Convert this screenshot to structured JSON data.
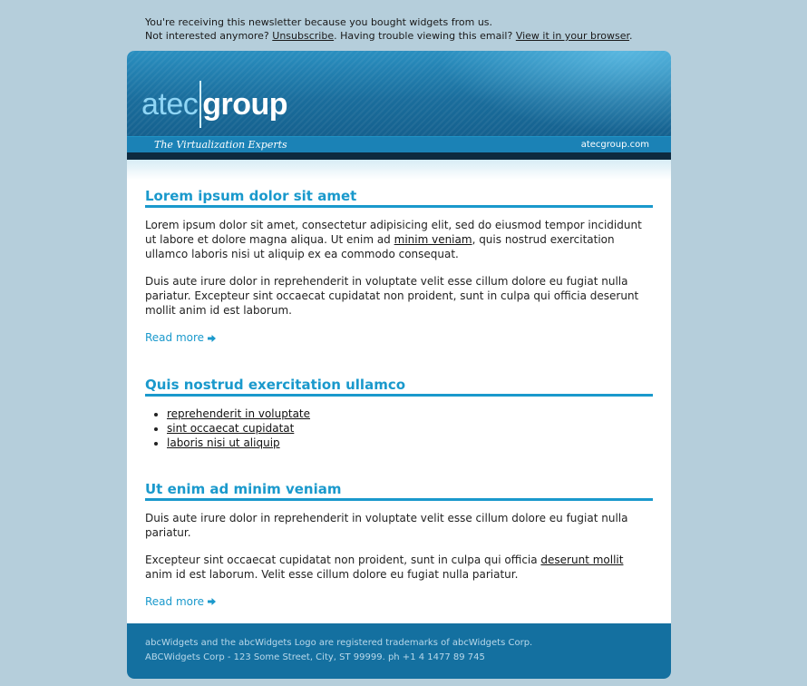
{
  "preheader": {
    "line1": "You're receiving this newsletter because you bought widgets from us.",
    "line2_prefix": "Not interested anymore? ",
    "unsubscribe": "Unsubscribe",
    "line2_middle": ". Having trouble viewing this email? ",
    "view_in_browser": "View it in your browser",
    "line2_suffix": "."
  },
  "header": {
    "logo_part1": "atec",
    "logo_part2": "group",
    "tagline": "The Virtualization Experts",
    "domain": "atecgroup.com"
  },
  "sections": [
    {
      "title": "Lorem ipsum dolor sit amet",
      "p1_before": "Lorem ipsum dolor sit amet, consectetur adipisicing elit, sed do eiusmod tempor incididunt ut labore et dolore magna aliqua. Ut enim ad ",
      "p1_link": "minim veniam",
      "p1_after": ", quis nostrud exercitation ullamco laboris nisi ut aliquip ex ea commodo consequat.",
      "p2": "Duis aute irure dolor in reprehenderit in voluptate velit esse cillum dolore eu fugiat nulla pariatur. Excepteur sint occaecat cupidatat non proident, sunt in culpa qui officia deserunt mollit anim id est laborum.",
      "read_more": "Read more"
    },
    {
      "title": "Quis nostrud exercitation ullamco",
      "links": [
        "reprehenderit in voluptate",
        "sint occaecat cupidatat",
        "laboris nisi ut aliquip"
      ]
    },
    {
      "title": "Ut enim ad minim veniam",
      "p1": "Duis aute irure dolor in reprehenderit in voluptate velit esse cillum dolore eu fugiat nulla pariatur.",
      "p2_before": "Excepteur sint occaecat cupidatat non proident, sunt in culpa qui officia ",
      "p2_link": "deserunt mollit",
      "p2_after": " anim id est laborum. Velit esse cillum dolore eu fugiat nulla pariatur.",
      "read_more": "Read more"
    }
  ],
  "footer": {
    "line1": "abcWidgets and the abcWidgets Logo are registered trademarks of abcWidgets Corp.",
    "line2": "ABCWidgets Corp - 123 Some Street, City, ST 99999. ph +1 4 1477 89 745"
  },
  "colors": {
    "accent": "#1a99cc",
    "background": "#b5cedb",
    "footer": "#1470a0"
  }
}
